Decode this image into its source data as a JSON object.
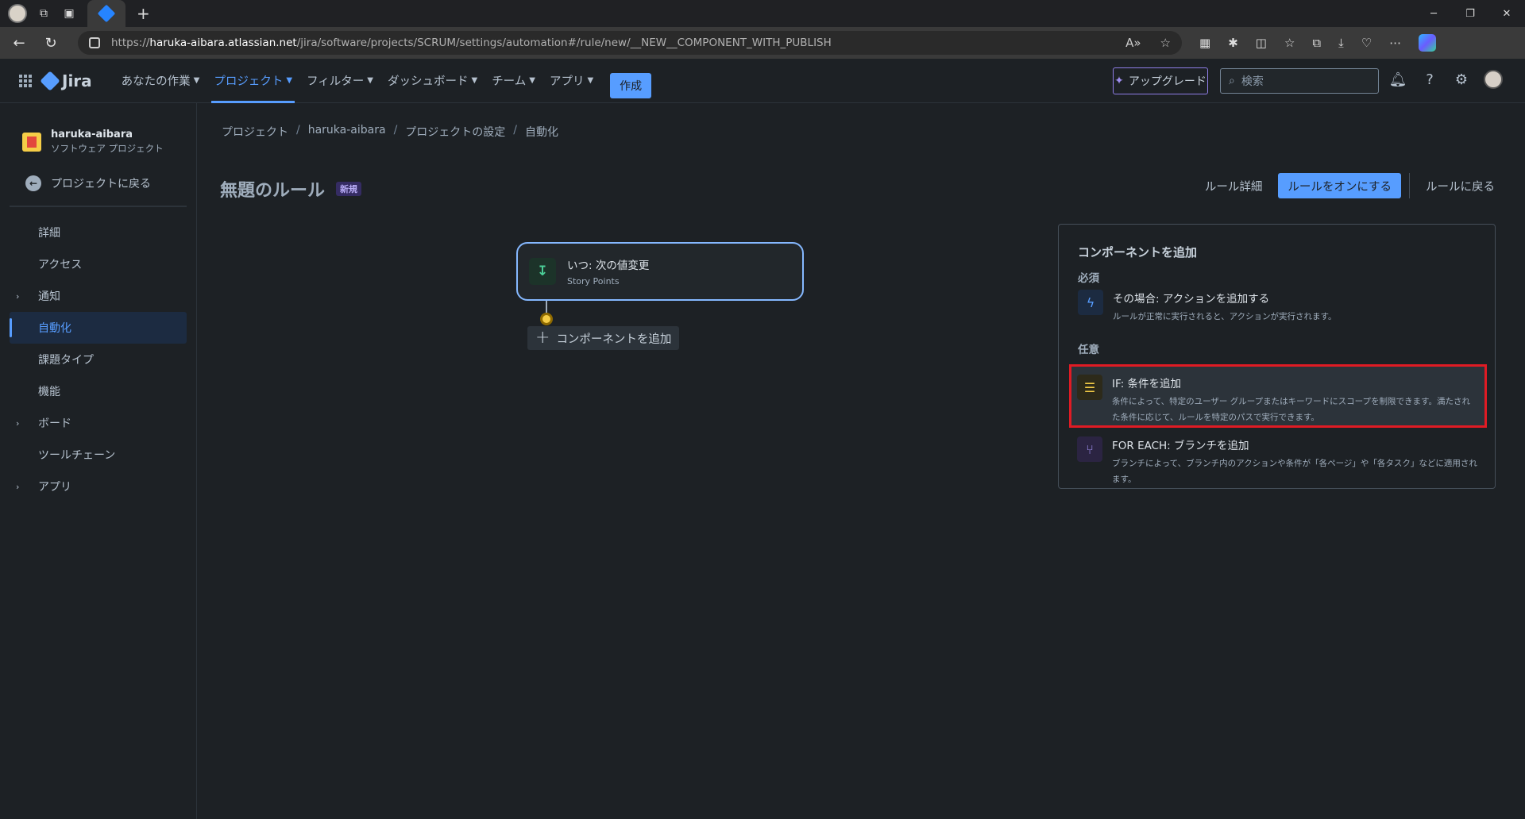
{
  "browser": {
    "url_scheme": "https://",
    "url_host": "haruka-aibara.atlassian.net",
    "url_path": "/jira/software/projects/SCRUM/settings/automation#/rule/new/__NEW__COMPONENT_WITH_PUBLISH"
  },
  "topnav": {
    "product": "Jira",
    "menu": [
      {
        "label": "あなたの作業"
      },
      {
        "label": "プロジェクト"
      },
      {
        "label": "フィルター"
      },
      {
        "label": "ダッシュボード"
      },
      {
        "label": "チーム"
      },
      {
        "label": "アプリ"
      }
    ],
    "create_label": "作成",
    "upgrade_label": "アップグレード",
    "search_placeholder": "検索"
  },
  "sidebar": {
    "project_name": "haruka-aibara",
    "project_type": "ソフトウェア プロジェクト",
    "back_label": "プロジェクトに戻る",
    "items": [
      {
        "label": "詳細"
      },
      {
        "label": "アクセス"
      },
      {
        "label": "通知"
      },
      {
        "label": "自動化"
      },
      {
        "label": "課題タイプ"
      },
      {
        "label": "機能"
      },
      {
        "label": "ボード"
      },
      {
        "label": "ツールチェーン"
      },
      {
        "label": "アプリ"
      }
    ]
  },
  "breadcrumb": [
    "プロジェクト",
    "haruka-aibara",
    "プロジェクトの設定",
    "自動化"
  ],
  "page": {
    "title": "無題のルール",
    "badge": "新規",
    "rule_details": "ルール詳細",
    "enable_rule": "ルールをオンにする",
    "back_to_rules": "ルールに戻る"
  },
  "canvas": {
    "trigger_title": "いつ: 次の値変更",
    "trigger_sub": "Story Points",
    "add_component": "コンポーネントを追加"
  },
  "panel": {
    "title": "コンポーネントを追加",
    "required_label": "必須",
    "optional_label": "任意",
    "action_title": "その場合: アクションを追加する",
    "action_desc": "ルールが正常に実行されると、アクションが実行されます。",
    "condition_title": "IF: 条件を追加",
    "condition_desc": "条件によって、特定のユーザー グループまたはキーワードにスコープを制限できます。満たされた条件に応じて、ルールを特定のパスで実行できます。",
    "branch_title": "FOR EACH: ブランチを追加",
    "branch_desc": "ブランチによって、ブランチ内のアクションや条件が「各ページ」や「各タスク」などに適用されます。"
  },
  "colors": {
    "accent": "#579dff",
    "highlight_box": "#e01b24",
    "trigger_border": "#85b8ff"
  }
}
